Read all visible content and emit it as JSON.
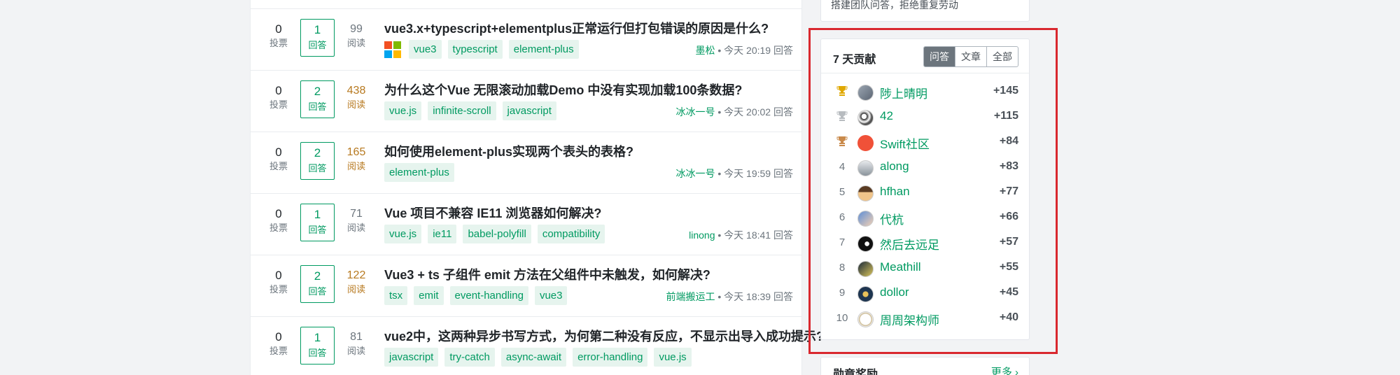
{
  "questions": [
    {
      "votes": "0",
      "votes_label": "投票",
      "answers": "1",
      "answers_label": "回答",
      "views": "99",
      "views_label": "阅读",
      "title": "vue3.x+typescript+elementplus正常运行但打包错误的原因是什么?",
      "tags": [
        "vue3",
        "typescript",
        "element-plus"
      ],
      "author": "墨松",
      "time": "今天 20:19 回答",
      "has_logo": true
    },
    {
      "votes": "0",
      "votes_label": "投票",
      "answers": "2",
      "answers_label": "回答",
      "views": "438",
      "views_label": "阅读",
      "title": "为什么这个Vue 无限滚动加载Demo 中没有实现加载100条数据?",
      "tags": [
        "vue.js",
        "infinite-scroll",
        "javascript"
      ],
      "author": "冰冰一号",
      "time": "今天 20:02 回答",
      "hot": true
    },
    {
      "votes": "0",
      "votes_label": "投票",
      "answers": "2",
      "answers_label": "回答",
      "views": "165",
      "views_label": "阅读",
      "title": "如何使用element-plus实现两个表头的表格?",
      "tags": [
        "element-plus"
      ],
      "author": "冰冰一号",
      "time": "今天 19:59 回答",
      "hot": true
    },
    {
      "votes": "0",
      "votes_label": "投票",
      "answers": "1",
      "answers_label": "回答",
      "views": "71",
      "views_label": "阅读",
      "title": "Vue 项目不兼容 IE11 浏览器如何解决?",
      "tags": [
        "vue.js",
        "ie11",
        "babel-polyfill",
        "compatibility"
      ],
      "author": "linong",
      "time": "今天 18:41 回答"
    },
    {
      "votes": "0",
      "votes_label": "投票",
      "answers": "2",
      "answers_label": "回答",
      "views": "122",
      "views_label": "阅读",
      "title": "Vue3 + ts 子组件 emit 方法在父组件中未触发，如何解决?",
      "tags": [
        "tsx",
        "emit",
        "event-handling",
        "vue3"
      ],
      "author": "前端搬运工",
      "time": "今天 18:39 回答",
      "hot": true
    },
    {
      "votes": "0",
      "votes_label": "投票",
      "answers": "1",
      "answers_label": "回答",
      "views": "81",
      "views_label": "阅读",
      "title": "vue2中，这两种异步书写方式，为何第二种没有反应，不显示出导入成功提示?",
      "tags": [
        "javascript",
        "try-catch",
        "async-await",
        "error-handling",
        "vue.js"
      ],
      "author": "",
      "time": ""
    }
  ],
  "sidebar": {
    "top_card_text": "搭建团队问答，拒绝重复劳动",
    "contrib": {
      "title": "7 天贡献",
      "tabs": [
        "问答",
        "文章",
        "全部"
      ],
      "active_tab": "问答",
      "ranks": [
        {
          "rank": "",
          "trophy": "gold",
          "name": "陟上晴明",
          "points": "+145"
        },
        {
          "rank": "",
          "trophy": "silver",
          "name": "42",
          "points": "+115"
        },
        {
          "rank": "",
          "trophy": "bronze",
          "name": "Swift社区",
          "points": "+84"
        },
        {
          "rank": "4",
          "name": "along",
          "points": "+83"
        },
        {
          "rank": "5",
          "name": "hfhan",
          "points": "+77"
        },
        {
          "rank": "6",
          "name": "代杭",
          "points": "+66"
        },
        {
          "rank": "7",
          "name": "然后去远足",
          "points": "+57"
        },
        {
          "rank": "8",
          "name": "Meathill",
          "points": "+55"
        },
        {
          "rank": "9",
          "name": "dollor",
          "points": "+45"
        },
        {
          "rank": "10",
          "name": "周周架构师",
          "points": "+40"
        }
      ]
    },
    "bottom_card": {
      "title": "勋章奖励",
      "more": "更多 ›"
    }
  },
  "colors": {
    "accent": "#009a61",
    "tag_bg": "#e6f4ee",
    "hot_views": "#b7791f",
    "highlight": "#d9282f",
    "gold": "#e0a800",
    "silver": "#b8bcc0",
    "bronze": "#c98a4b"
  }
}
